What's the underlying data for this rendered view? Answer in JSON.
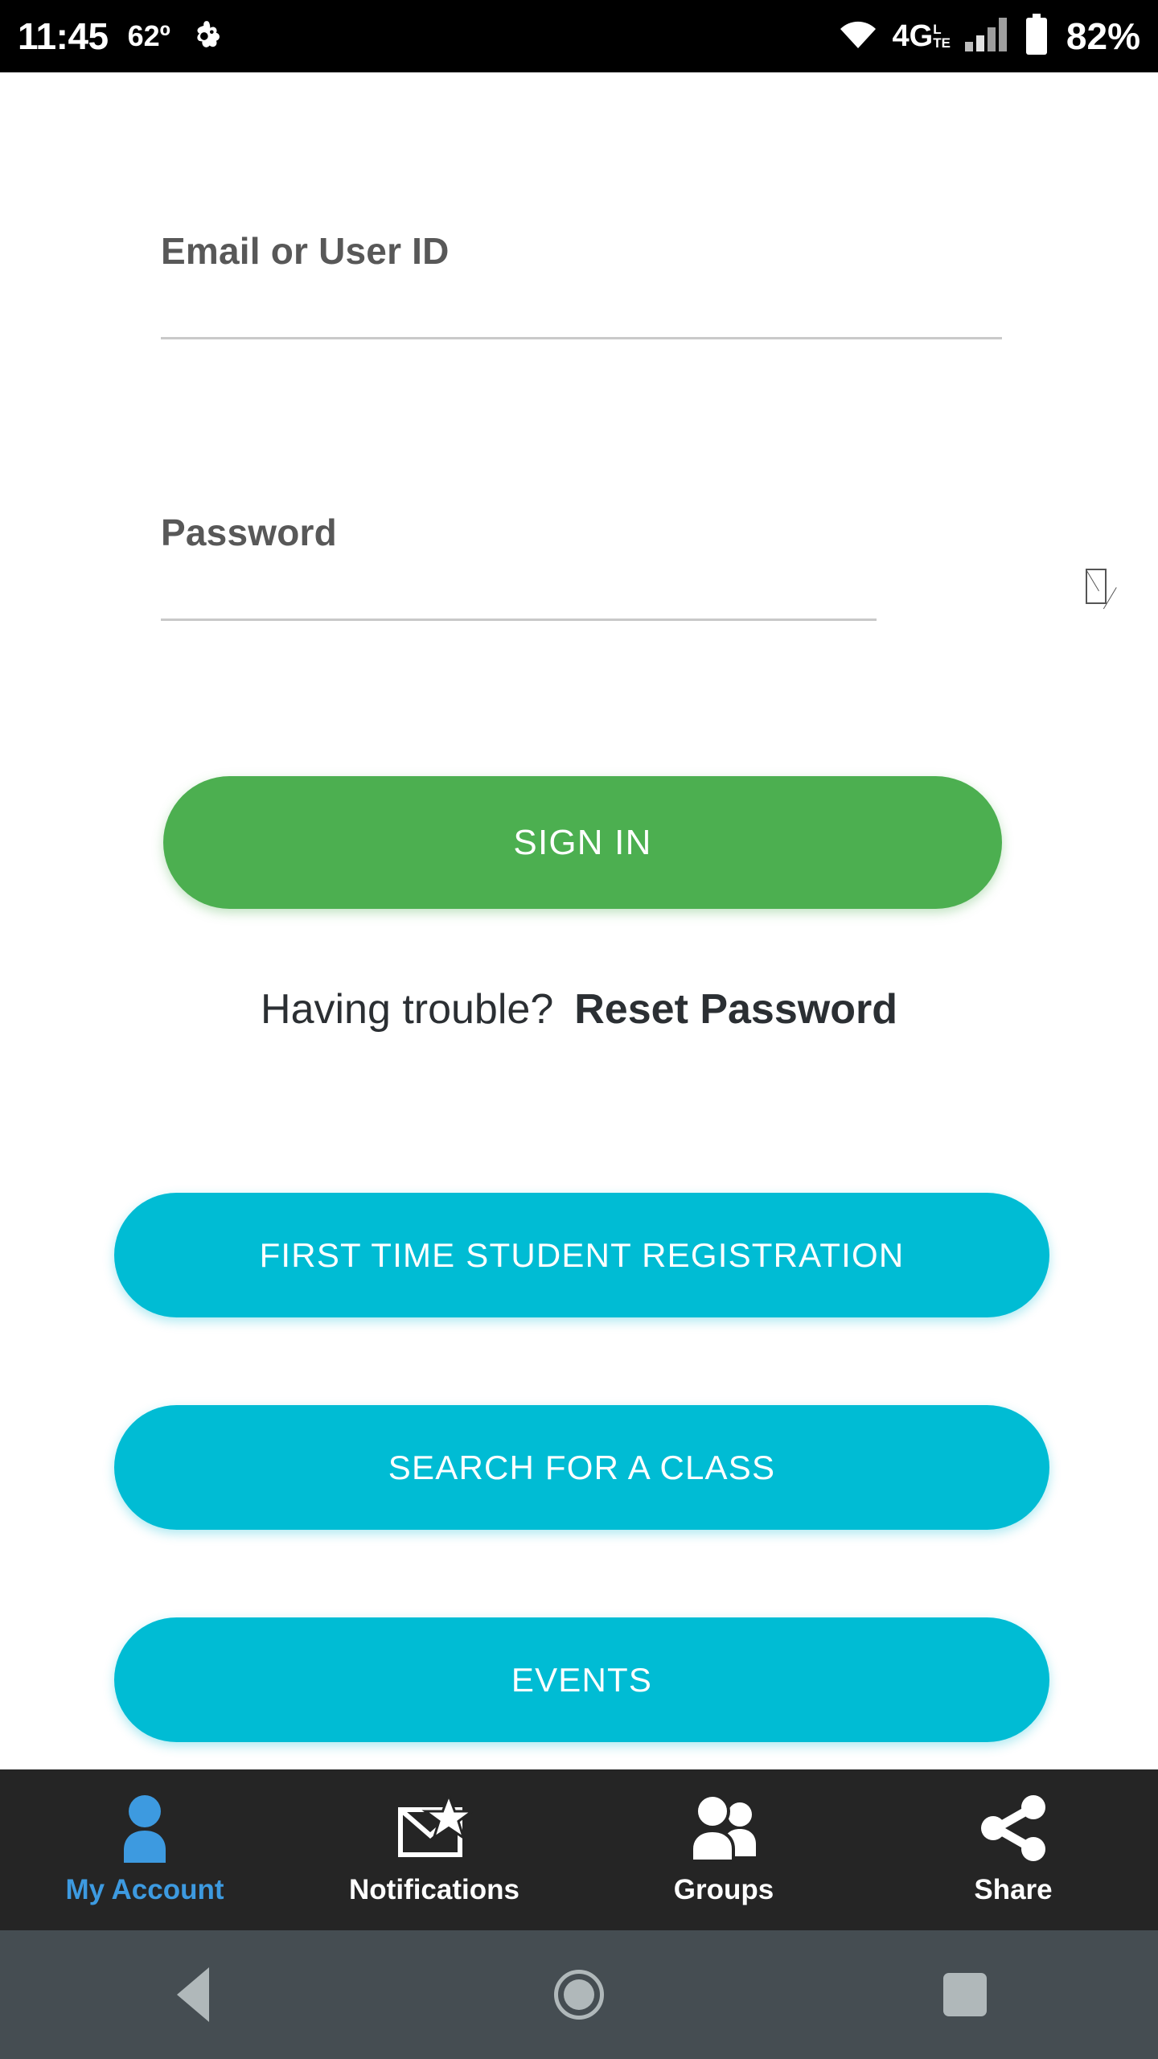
{
  "statusbar": {
    "time": "11:45",
    "temperature": "62º",
    "weather_icon": "weather-icon",
    "wifi_icon": "wifi-icon",
    "network_label": "4G",
    "network_sub_top": "L",
    "network_sub_bottom": "TE",
    "signal_icon": "cellular-signal-icon",
    "battery_icon": "battery-icon",
    "battery_percent": "82%"
  },
  "form": {
    "email": {
      "label": "Email or User ID",
      "value": "",
      "placeholder": ""
    },
    "password": {
      "label": "Password",
      "value": "",
      "placeholder": "",
      "toggle_icon": "show-password-icon"
    },
    "sign_in_label": "SIGN IN"
  },
  "help": {
    "question": "Having trouble?",
    "reset_label": "Reset Password"
  },
  "actions": [
    {
      "label": "FIRST TIME STUDENT REGISTRATION"
    },
    {
      "label": "SEARCH FOR A CLASS"
    },
    {
      "label": "EVENTS"
    }
  ],
  "tabs": [
    {
      "label": "My Account",
      "icon": "person-icon",
      "active": true
    },
    {
      "label": "Notifications",
      "icon": "envelope-star-icon",
      "active": false
    },
    {
      "label": "Groups",
      "icon": "people-group-icon",
      "active": false
    },
    {
      "label": "Share",
      "icon": "share-nodes-icon",
      "active": false
    }
  ],
  "navbar": {
    "back": "back-triangle-icon",
    "home": "home-circle-icon",
    "recents": "recents-square-icon"
  },
  "colors": {
    "primary_green": "#4caf50",
    "accent_cyan": "#00bcd4",
    "active_tab_blue": "#3d9ae0",
    "tabbar_bg": "#252525",
    "navbar_bg": "#454d52",
    "label_gray": "#585858",
    "underline_gray": "#c9c9c9"
  }
}
